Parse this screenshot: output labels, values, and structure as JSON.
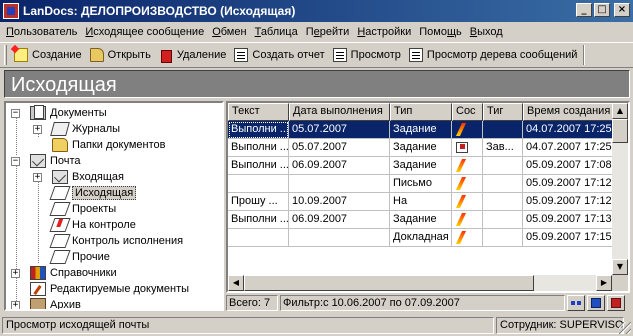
{
  "window": {
    "title": "LanDocs: ДЕЛОПРОИЗВОДСТВО (Исходящая)",
    "minimize": "_",
    "maximize": "□",
    "close": "×"
  },
  "menu": [
    {
      "pre": "",
      "ul": "П",
      "post": "ользователь"
    },
    {
      "pre": "",
      "ul": "И",
      "post": "сходящее сообщение"
    },
    {
      "pre": "",
      "ul": "О",
      "post": "бмен"
    },
    {
      "pre": "",
      "ul": "Т",
      "post": "аблица"
    },
    {
      "pre": "П",
      "ul": "е",
      "post": "рейти"
    },
    {
      "pre": "",
      "ul": "Н",
      "post": "астройки"
    },
    {
      "pre": "Помо",
      "ul": "щ",
      "post": "ь"
    },
    {
      "pre": "",
      "ul": "В",
      "post": "ыход"
    }
  ],
  "toolbar": {
    "create": "Создание",
    "open": "Открыть",
    "delete": "Удаление",
    "report": "Создать отчет",
    "view": "Просмотр",
    "view_tree": "Просмотр дерева сообщений"
  },
  "heading": "Исходящая",
  "tree": [
    {
      "label": "Документы",
      "icon": "docs-icon",
      "expander": "−"
    },
    {
      "label": "Журналы",
      "icon": "journal-icon",
      "expander": "+"
    },
    {
      "label": "Папки документов",
      "icon": "folder-icon",
      "expander": ""
    },
    {
      "label": "Почта",
      "icon": "mail-icon",
      "expander": "−"
    },
    {
      "label": "Входящая",
      "icon": "inbox-icon",
      "expander": "+"
    },
    {
      "label": "Исходящая",
      "icon": "outbox-icon",
      "expander": ""
    },
    {
      "label": "Проекты",
      "icon": "projects-icon",
      "expander": ""
    },
    {
      "label": "На контроле",
      "icon": "control-icon",
      "expander": ""
    },
    {
      "label": "Контроль исполнения",
      "icon": "execution-control-icon",
      "expander": ""
    },
    {
      "label": "Прочие",
      "icon": "other-icon",
      "expander": ""
    },
    {
      "label": "Справочники",
      "icon": "books-icon",
      "expander": "+"
    },
    {
      "label": "Редактируемые документы",
      "icon": "edit-docs-icon",
      "expander": ""
    },
    {
      "label": "Архив",
      "icon": "archive-icon",
      "expander": "+"
    }
  ],
  "grid": {
    "columns": [
      "Текст",
      "Дата выполнения",
      "Тип",
      "Сос",
      "Тиг",
      "Время создания"
    ],
    "rows": [
      [
        "Выполни ...",
        "05.07.2007",
        "Задание",
        "bolt",
        "",
        "04.07.2007 17:25:2"
      ],
      [
        "Выполни ...",
        "05.07.2007",
        "Задание",
        "envelope",
        "Зав...",
        "04.07.2007 17:25:2"
      ],
      [
        "Выполни ...",
        "06.09.2007",
        "Задание",
        "bolt",
        "",
        "05.09.2007 17:08:1"
      ],
      [
        "",
        "",
        "Письмо",
        "bolt",
        "",
        "05.09.2007 17:12:1"
      ],
      [
        "Прошу ...",
        "10.09.2007",
        "На",
        "bolt",
        "",
        "05.09.2007 17:12:5"
      ],
      [
        "Выполни ...",
        "06.09.2007",
        "Задание",
        "bolt",
        "",
        "05.09.2007 17:13:2"
      ],
      [
        "",
        "",
        "Докладная",
        "bolt",
        "",
        "05.09.2007 17:15:1"
      ]
    ]
  },
  "footer": {
    "count": "Всего: 7",
    "filter": "Фильтр:с 10.06.2007 по 07.09.2007"
  },
  "status": {
    "left": "Просмотр исходящей почты",
    "right": "Сотрудник: SUPERVISOR"
  }
}
